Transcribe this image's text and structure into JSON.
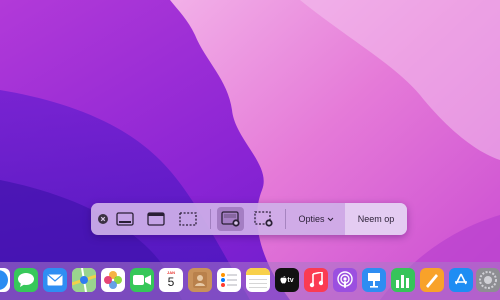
{
  "toolbar": {
    "options_label": "Opties",
    "capture_label": "Neem op"
  },
  "dock": {
    "calendar_month": "JAN",
    "calendar_day": "5",
    "tv_label": "tv"
  },
  "colors": {
    "wallpaper_purple": "#7a1fd6",
    "wallpaper_pink": "#e36ad6",
    "toolbar_bg": "#ceb0e8"
  }
}
